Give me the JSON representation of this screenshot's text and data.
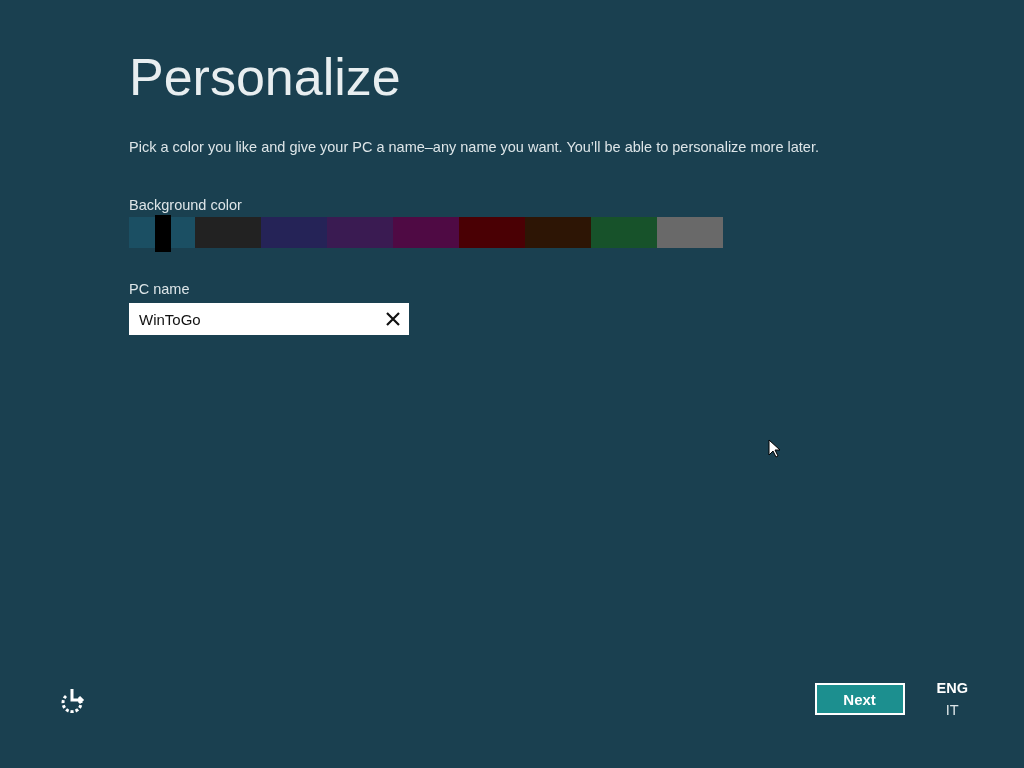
{
  "title": "Personalize",
  "description": "Pick a color you like and give your PC a name–any name you want. You’ll be able to personalize more later.",
  "background_color": {
    "label": "Background color",
    "swatches": [
      {
        "color": "#1b4f63",
        "selected": true
      },
      {
        "color": "#222222",
        "selected": false
      },
      {
        "color": "#252357",
        "selected": false
      },
      {
        "color": "#3a1b52",
        "selected": false
      },
      {
        "color": "#4f0a44",
        "selected": false
      },
      {
        "color": "#4a0004",
        "selected": false
      },
      {
        "color": "#2d1505",
        "selected": false
      },
      {
        "color": "#17522a",
        "selected": false
      },
      {
        "color": "#696969",
        "selected": false
      }
    ]
  },
  "pc_name": {
    "label": "PC name",
    "value": "WinToGo"
  },
  "next_button": "Next",
  "language": {
    "primary": "ENG",
    "secondary": "IT"
  }
}
